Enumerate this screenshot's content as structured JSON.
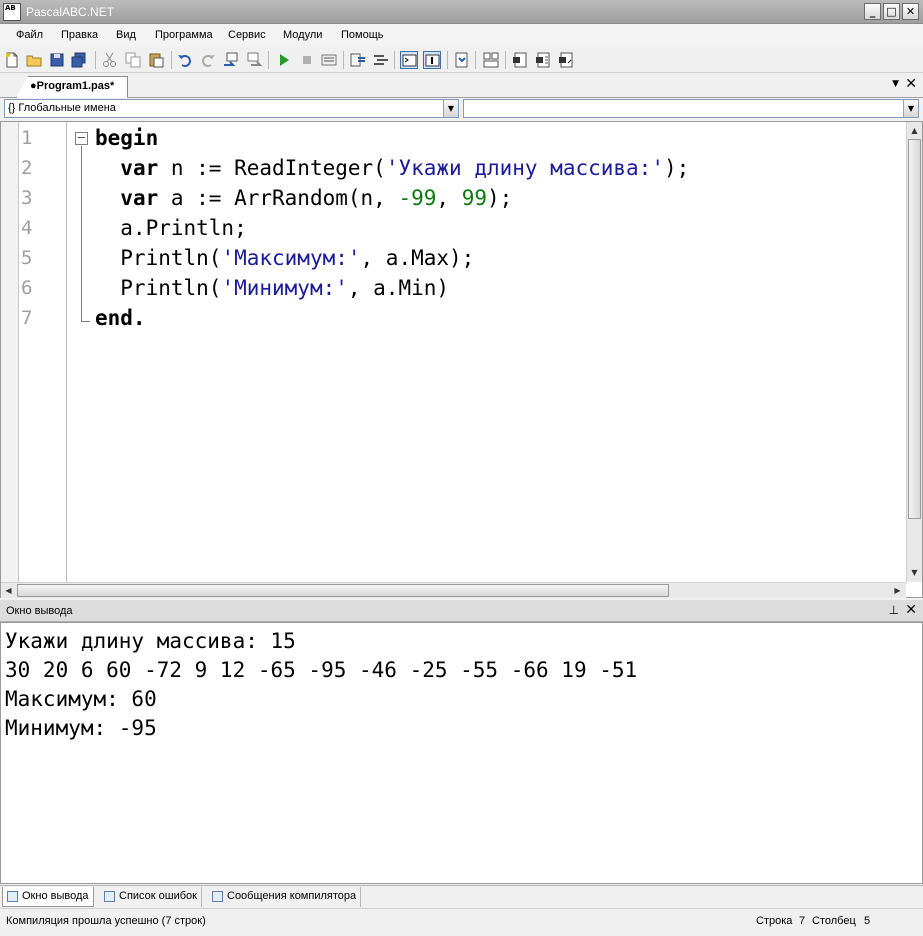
{
  "window": {
    "title": "PascalABC.NET",
    "icon_label": "AB",
    "minimize": "_",
    "maximize": "□",
    "close": "✕"
  },
  "menu": [
    "Файл",
    "Правка",
    "Вид",
    "Программа",
    "Сервис",
    "Модули",
    "Помощь"
  ],
  "toolbar": {
    "icons": [
      "new-file-icon",
      "open-file-icon",
      "save-icon",
      "save-all-icon",
      "cut-icon",
      "copy-icon",
      "paste-icon",
      "undo-icon",
      "redo-icon",
      "find-icon",
      "replace-icon",
      "run-icon",
      "stop-icon",
      "debug-icon",
      "format-icon",
      "comment-icon",
      "console-icon",
      "step-icon",
      "compile-icon",
      "options-icon",
      "module-icon",
      "list-icon",
      "refresh-icon"
    ]
  },
  "tab": {
    "label": "●Program1.pas*",
    "list_arrow": "▼",
    "close": "✕"
  },
  "scope_combo": {
    "value": "{} Глобальные имена"
  },
  "member_combo": {
    "value": ""
  },
  "editor": {
    "line_numbers": [
      "1",
      "2",
      "3",
      "4",
      "5",
      "6",
      "7"
    ],
    "fold": "−",
    "lines": [
      [
        {
          "t": "begin",
          "c": "kw"
        }
      ],
      [
        {
          "t": "  ",
          "c": "id"
        },
        {
          "t": "var",
          "c": "kw"
        },
        {
          "t": " n := ReadInteger(",
          "c": "id"
        },
        {
          "t": "'Укажи длину массива:'",
          "c": "str"
        },
        {
          "t": ");",
          "c": "id"
        }
      ],
      [
        {
          "t": "  ",
          "c": "id"
        },
        {
          "t": "var",
          "c": "kw"
        },
        {
          "t": " a := ArrRandom(n, ",
          "c": "id"
        },
        {
          "t": "-99",
          "c": "num"
        },
        {
          "t": ", ",
          "c": "id"
        },
        {
          "t": "99",
          "c": "num"
        },
        {
          "t": ");",
          "c": "id"
        }
      ],
      [
        {
          "t": "  a.Println;",
          "c": "id"
        }
      ],
      [
        {
          "t": "  Println(",
          "c": "id"
        },
        {
          "t": "'Максимум:'",
          "c": "str"
        },
        {
          "t": ", a.Max);",
          "c": "id"
        }
      ],
      [
        {
          "t": "  Println(",
          "c": "id"
        },
        {
          "t": "'Минимум:'",
          "c": "str"
        },
        {
          "t": ", a.Min)",
          "c": "id"
        }
      ],
      [
        {
          "t": "end.",
          "c": "kw"
        }
      ]
    ]
  },
  "output_panel": {
    "title": "Окно вывода",
    "pin": "⊥",
    "close": "✕",
    "lines": [
      "Укажи длину массива: 15",
      "30 20 6 60 -72 9 12 -65 -95 -46 -25 -55 -66 19 -51",
      "Максимум: 60",
      "Минимум: -95"
    ]
  },
  "bottom_tabs": [
    {
      "label": "Окно вывода",
      "active": true
    },
    {
      "label": "Список ошибок",
      "active": false
    },
    {
      "label": "Сообщения компилятора",
      "active": false
    }
  ],
  "status": {
    "message": "Компиляция прошла успешно (7 строк)",
    "row_label": "Строка",
    "row": "7",
    "col_label": "Столбец",
    "col": "5"
  }
}
